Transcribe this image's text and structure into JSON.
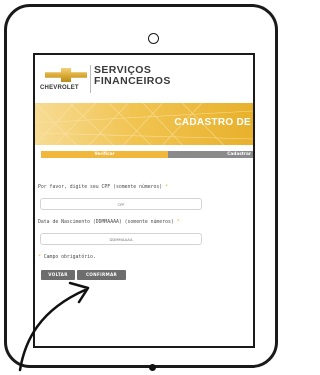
{
  "brand": {
    "chevrolet": "CHEVROLET",
    "line1": "SERVIÇOS",
    "line2": "FINANCEIROS",
    "bowtie_color": "#d9a933"
  },
  "banner": {
    "title": "CADASTRO DE",
    "color": "#f1c451"
  },
  "steps": {
    "active": "Verificar",
    "inactive": "Cadastrar",
    "active_color": "#f0b73a",
    "inactive_color": "#8a8a8a"
  },
  "form": {
    "cpf_label": "Por favor, digite seu CPF (somente números)",
    "cpf_placeholder": "CPF",
    "dob_label": "Data de Nascimento (DDMMAAAA) (somente números)",
    "dob_placeholder": "DDMMAAAA",
    "required_mark": "*",
    "required_note": "Campo obrigatório."
  },
  "buttons": {
    "back": "VOLTAR",
    "confirm": "CONFIRMAR"
  }
}
